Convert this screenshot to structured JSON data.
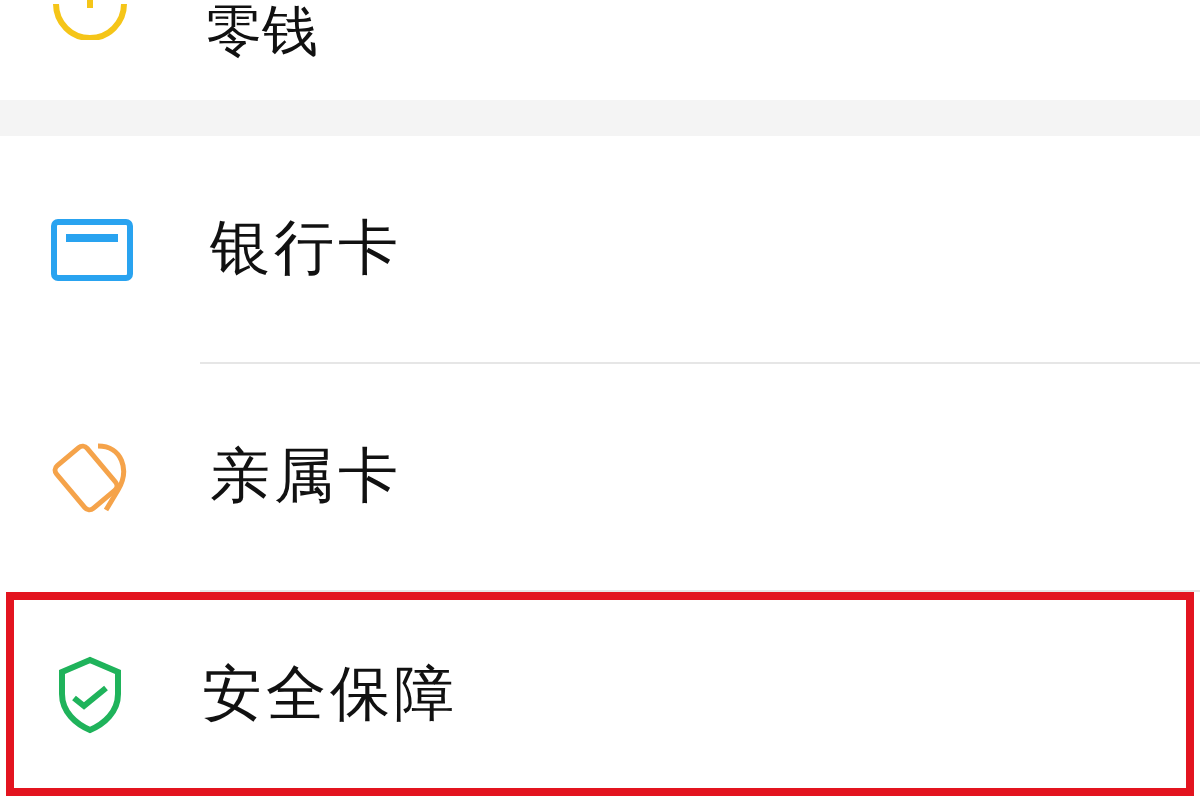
{
  "top_item": {
    "label": "零钱",
    "kind": "coin"
  },
  "menu_items": [
    {
      "label": "银行卡",
      "kind": "card",
      "highlighted": false
    },
    {
      "label": "亲属卡",
      "kind": "family",
      "highlighted": false
    },
    {
      "label": "安全保障",
      "kind": "shield",
      "highlighted": true
    }
  ]
}
